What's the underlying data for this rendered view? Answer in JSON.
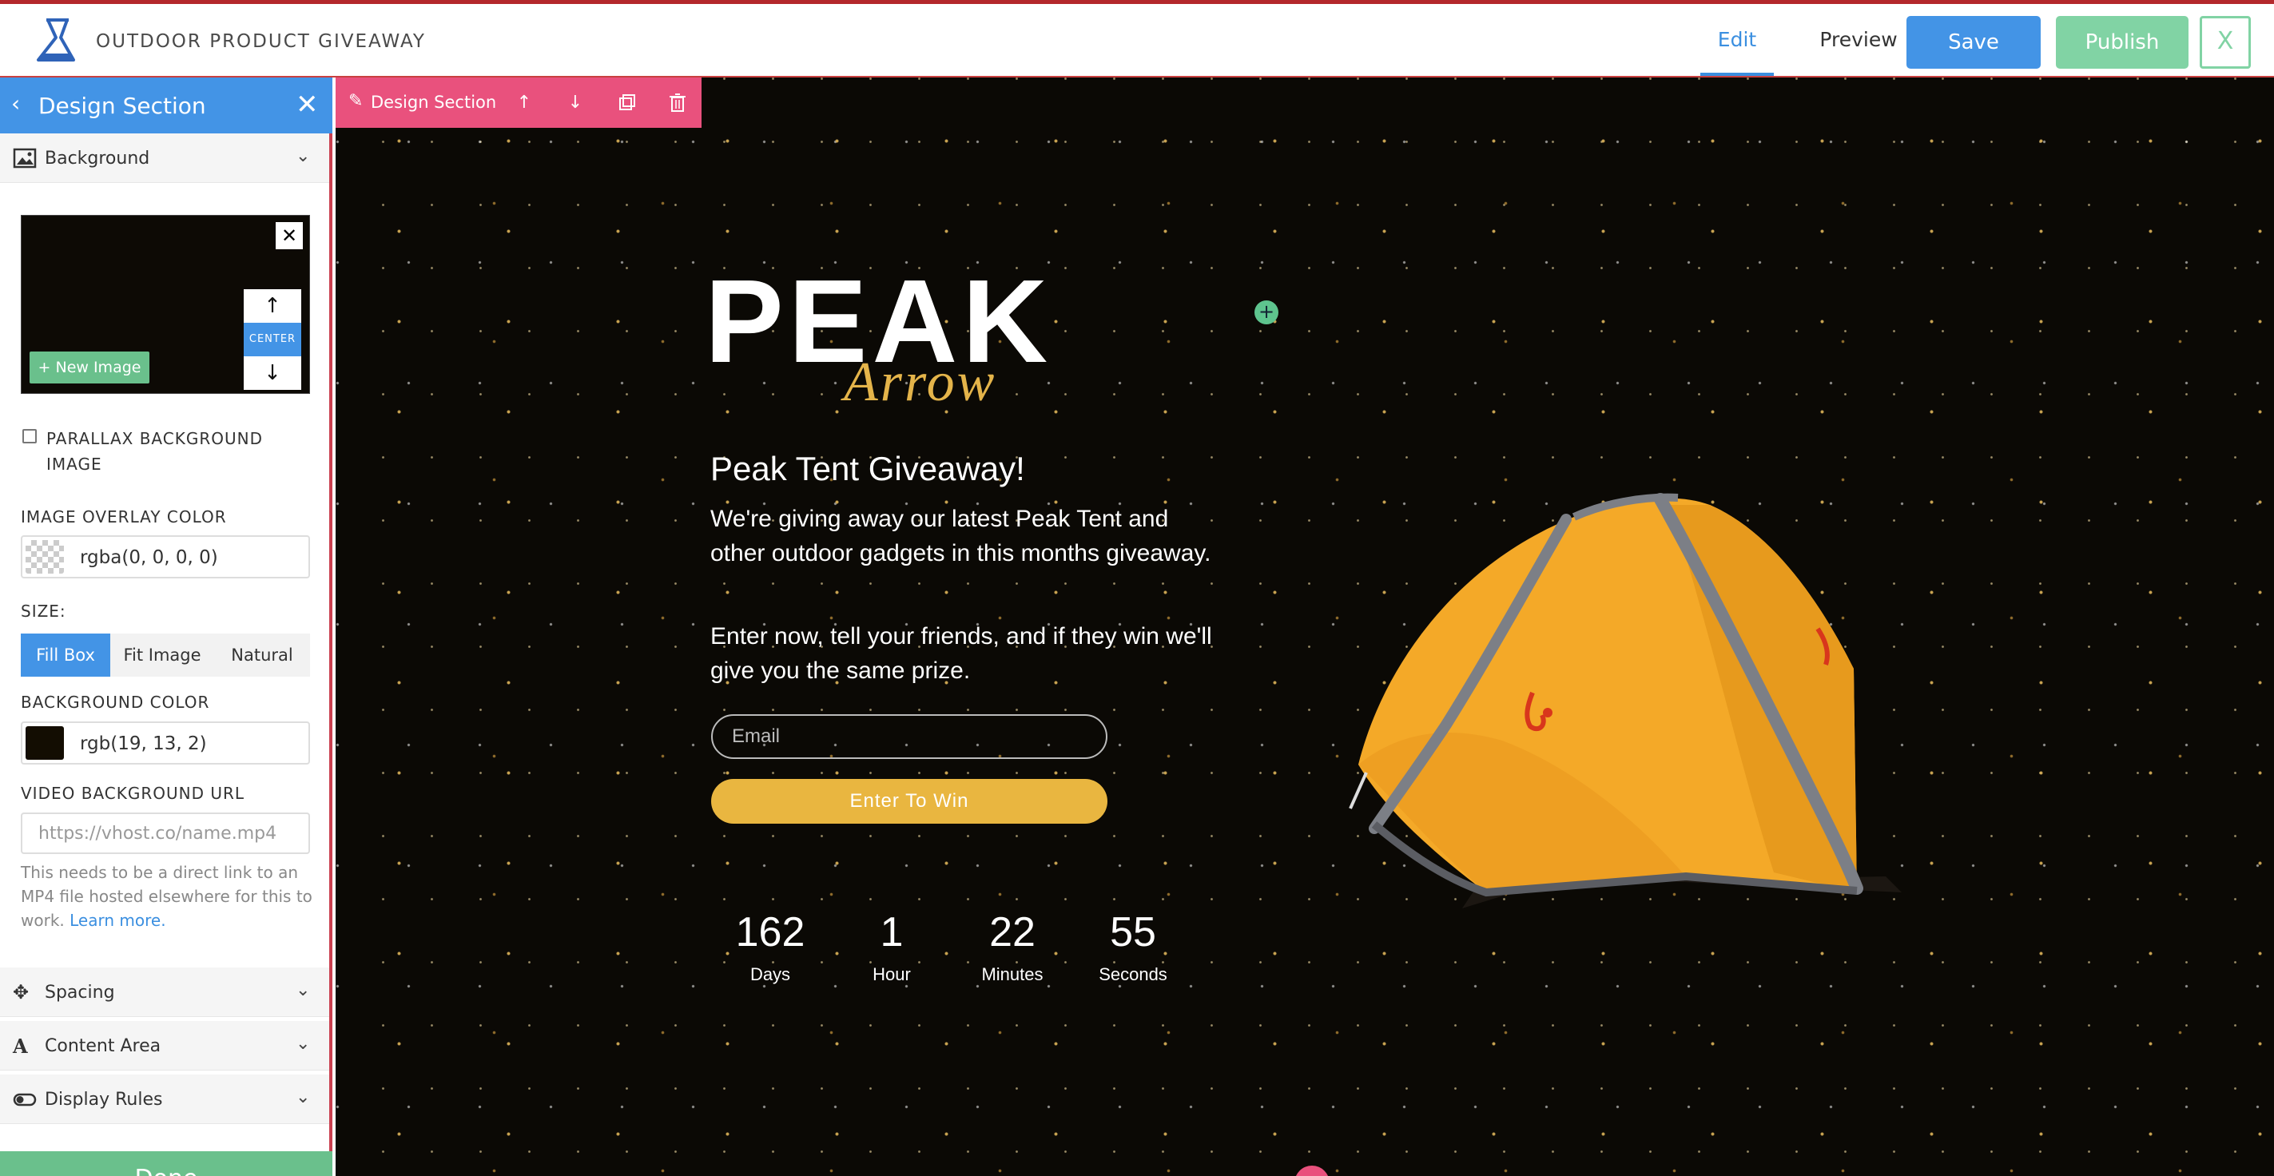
{
  "app": {
    "title": "OUTDOOR PRODUCT GIVEAWAY",
    "logo_icon": "flask-icon"
  },
  "header": {
    "tabs": [
      {
        "label": "Edit",
        "active": true
      },
      {
        "label": "Preview",
        "active": false
      }
    ],
    "save_label": "Save",
    "publish_label": "Publish",
    "exit_label": "X"
  },
  "sidebar": {
    "title": "Design Section",
    "sections": {
      "background": {
        "label": "Background",
        "icon": "image-icon"
      },
      "spacing": {
        "label": "Spacing",
        "icon": "move-arrows-icon"
      },
      "content_area": {
        "label": "Content Area",
        "icon": "font-a-icon"
      },
      "display_rules": {
        "label": "Display Rules",
        "icon": "toggle-icon"
      }
    },
    "image": {
      "position_label": "CENTER",
      "new_image_label": "+ New Image"
    },
    "parallax_label": "PARALLAX BACKGROUND IMAGE",
    "parallax_checked": false,
    "overlay_label": "IMAGE OVERLAY COLOR",
    "overlay_value": "rgba(0, 0, 0, 0)",
    "size_label": "SIZE:",
    "size_options": [
      "Fill Box",
      "Fit Image",
      "Natural"
    ],
    "size_selected": "Fill Box",
    "bg_color_label": "BACKGROUND COLOR",
    "bg_color_value": "rgb(19, 13, 2)",
    "video_label": "VIDEO BACKGROUND URL",
    "video_placeholder": "https://vhost.co/name.mp4",
    "video_value": "",
    "help_text": "This needs to be a direct link to an MP4 file hosted elsewhere for this to work.",
    "help_link": "Learn more.",
    "done_label": "Done"
  },
  "section_toolbar": {
    "label": "Design Section",
    "tools": [
      "move-up-icon",
      "move-down-icon",
      "duplicate-icon",
      "trash-icon"
    ]
  },
  "page": {
    "logo_main": "PEAK",
    "logo_script": "Arrow",
    "headline": "Peak Tent Giveaway!",
    "paragraph_1": "We're giving away our latest Peak Tent and other outdoor gadgets in this months giveaway.",
    "paragraph_2": "Enter now, tell your friends, and if they win we'll give you the same prize.",
    "email_placeholder": "Email",
    "cta_label": "Enter To Win",
    "countdown": [
      {
        "value": "162",
        "label": "Days"
      },
      {
        "value": "1",
        "label": "Hour"
      },
      {
        "value": "22",
        "label": "Minutes"
      },
      {
        "value": "55",
        "label": "Seconds"
      }
    ]
  },
  "colors": {
    "accent_blue": "#4394e6",
    "publish_green": "#81d3a4",
    "toolbar_pink": "#e9517d",
    "cta_gold": "#e9b640",
    "canvas_bg": "#130d02"
  }
}
